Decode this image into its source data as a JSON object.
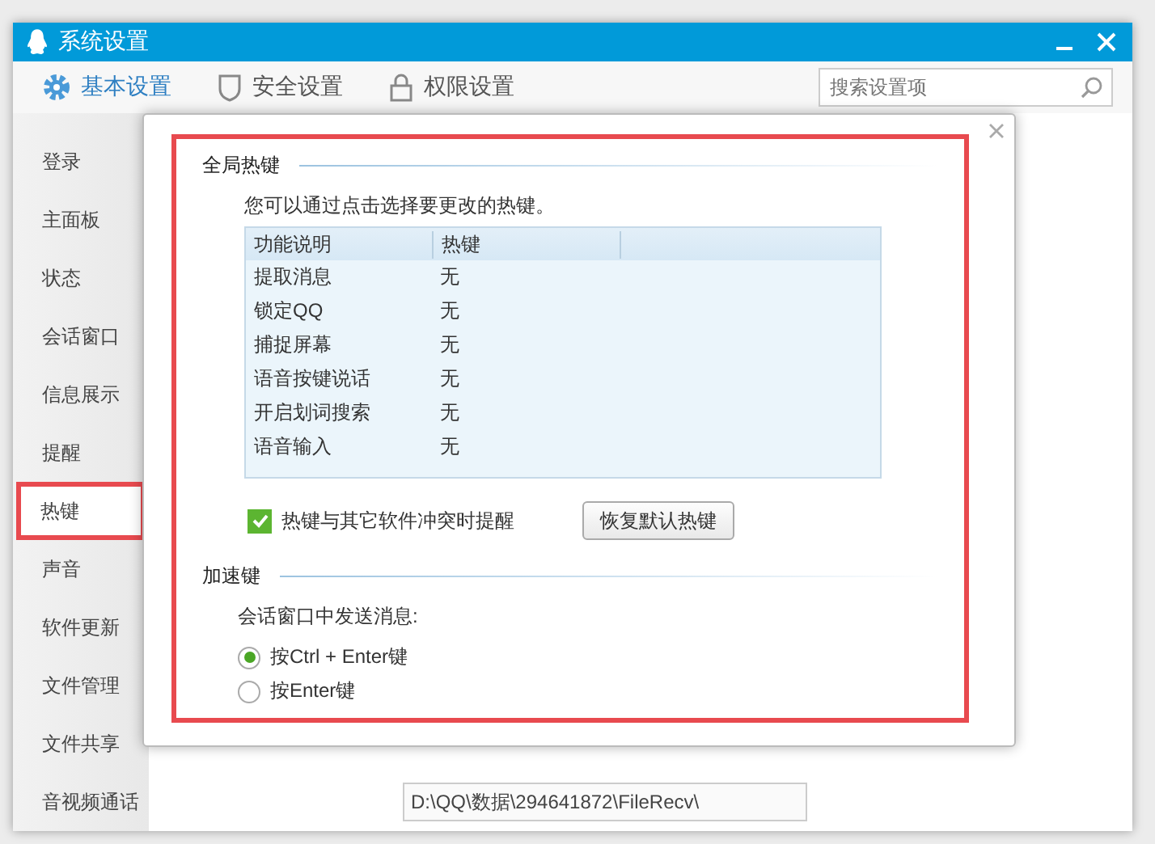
{
  "window": {
    "title": "系统设置"
  },
  "toolbar_tabs": [
    {
      "label": "基本设置",
      "selected": true
    },
    {
      "label": "安全设置",
      "selected": false
    },
    {
      "label": "权限设置",
      "selected": false
    }
  ],
  "search": {
    "placeholder": "搜索设置项"
  },
  "sidebar": {
    "items": [
      {
        "label": "登录",
        "selected": false
      },
      {
        "label": "主面板",
        "selected": false
      },
      {
        "label": "状态",
        "selected": false
      },
      {
        "label": "会话窗口",
        "selected": false
      },
      {
        "label": "信息展示",
        "selected": false
      },
      {
        "label": "提醒",
        "selected": false
      },
      {
        "label": "热键",
        "selected": true
      },
      {
        "label": "声音",
        "selected": false
      },
      {
        "label": "软件更新",
        "selected": false
      },
      {
        "label": "文件管理",
        "selected": false
      },
      {
        "label": "文件共享",
        "selected": false
      },
      {
        "label": "音视频通话",
        "selected": false
      }
    ]
  },
  "path_field": {
    "value": "D:\\QQ\\数据\\294641872\\FileRecv\\"
  },
  "dialog": {
    "global_hotkeys": {
      "title": "全局热键",
      "description": "您可以通过点击选择要更改的热键。",
      "table": {
        "columns": [
          "功能说明",
          "热键"
        ],
        "rows": [
          [
            "提取消息",
            "无"
          ],
          [
            "锁定QQ",
            "无"
          ],
          [
            "捕捉屏幕",
            "无"
          ],
          [
            "语音按键说话",
            "无"
          ],
          [
            "开启划词搜索",
            "无"
          ],
          [
            "语音输入",
            "无"
          ]
        ]
      },
      "conflict_alert": {
        "label": "热键与其它软件冲突时提醒",
        "checked": true
      },
      "restore_button": "恢复默认热键"
    },
    "accelerators": {
      "title": "加速键",
      "prompt": "会话窗口中发送消息:",
      "options": [
        {
          "label": "按Ctrl + Enter键",
          "selected": true
        },
        {
          "label": "按Enter键",
          "selected": false
        }
      ]
    }
  }
}
